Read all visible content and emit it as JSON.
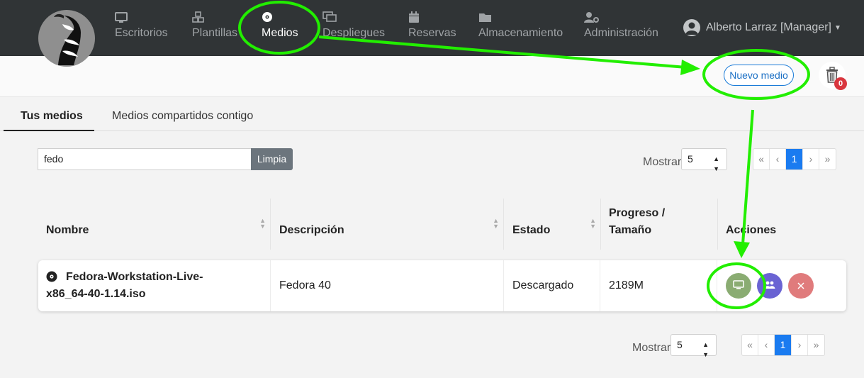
{
  "navbar": {
    "items": [
      {
        "label": "Escritorios",
        "icon": "desktop-icon"
      },
      {
        "label": "Plantillas",
        "icon": "cubes-icon"
      },
      {
        "label": "Medios",
        "icon": "disc-icon",
        "active": true
      },
      {
        "label": "Despliegues",
        "icon": "deployments-icon"
      },
      {
        "label": "Reservas",
        "icon": "calendar-icon"
      },
      {
        "label": "Almacenamiento",
        "icon": "folder-icon"
      },
      {
        "label": "Administración",
        "icon": "user-cog-icon"
      }
    ],
    "user": "Alberto Larraz [Manager]"
  },
  "subbar": {
    "new_button": "Nuevo medio",
    "trash_count": "0"
  },
  "tabs": [
    {
      "label": "Tus medios",
      "active": true
    },
    {
      "label": "Medios compartidos contigo"
    }
  ],
  "search": {
    "value": "fedo",
    "clear_label": "Limpia"
  },
  "pagination": {
    "show_label": "Mostrar",
    "page_size": "5",
    "first": "«",
    "prev": "‹",
    "current": "1",
    "next": "›",
    "last": "»"
  },
  "table": {
    "headers": [
      "Nombre",
      "Descripción",
      "Estado",
      "Progreso / Tamaño",
      "Acciones"
    ],
    "header_lines": {
      "progress_1": "Progreso /",
      "progress_2": "Tamaño"
    },
    "rows": [
      {
        "name_1": "Fedora-Workstation-Live-",
        "name_2": "x86_64-40-1.14.iso",
        "description": "Fedora 40",
        "status": "Descargado",
        "size": "2189M"
      }
    ]
  },
  "colors": {
    "navbar": "#303436",
    "primary": "#1a7bf0",
    "action_desktop": "#8aac72",
    "action_share": "#6a63d3",
    "action_delete": "#e07b7c",
    "annotation": "#22ee00"
  }
}
